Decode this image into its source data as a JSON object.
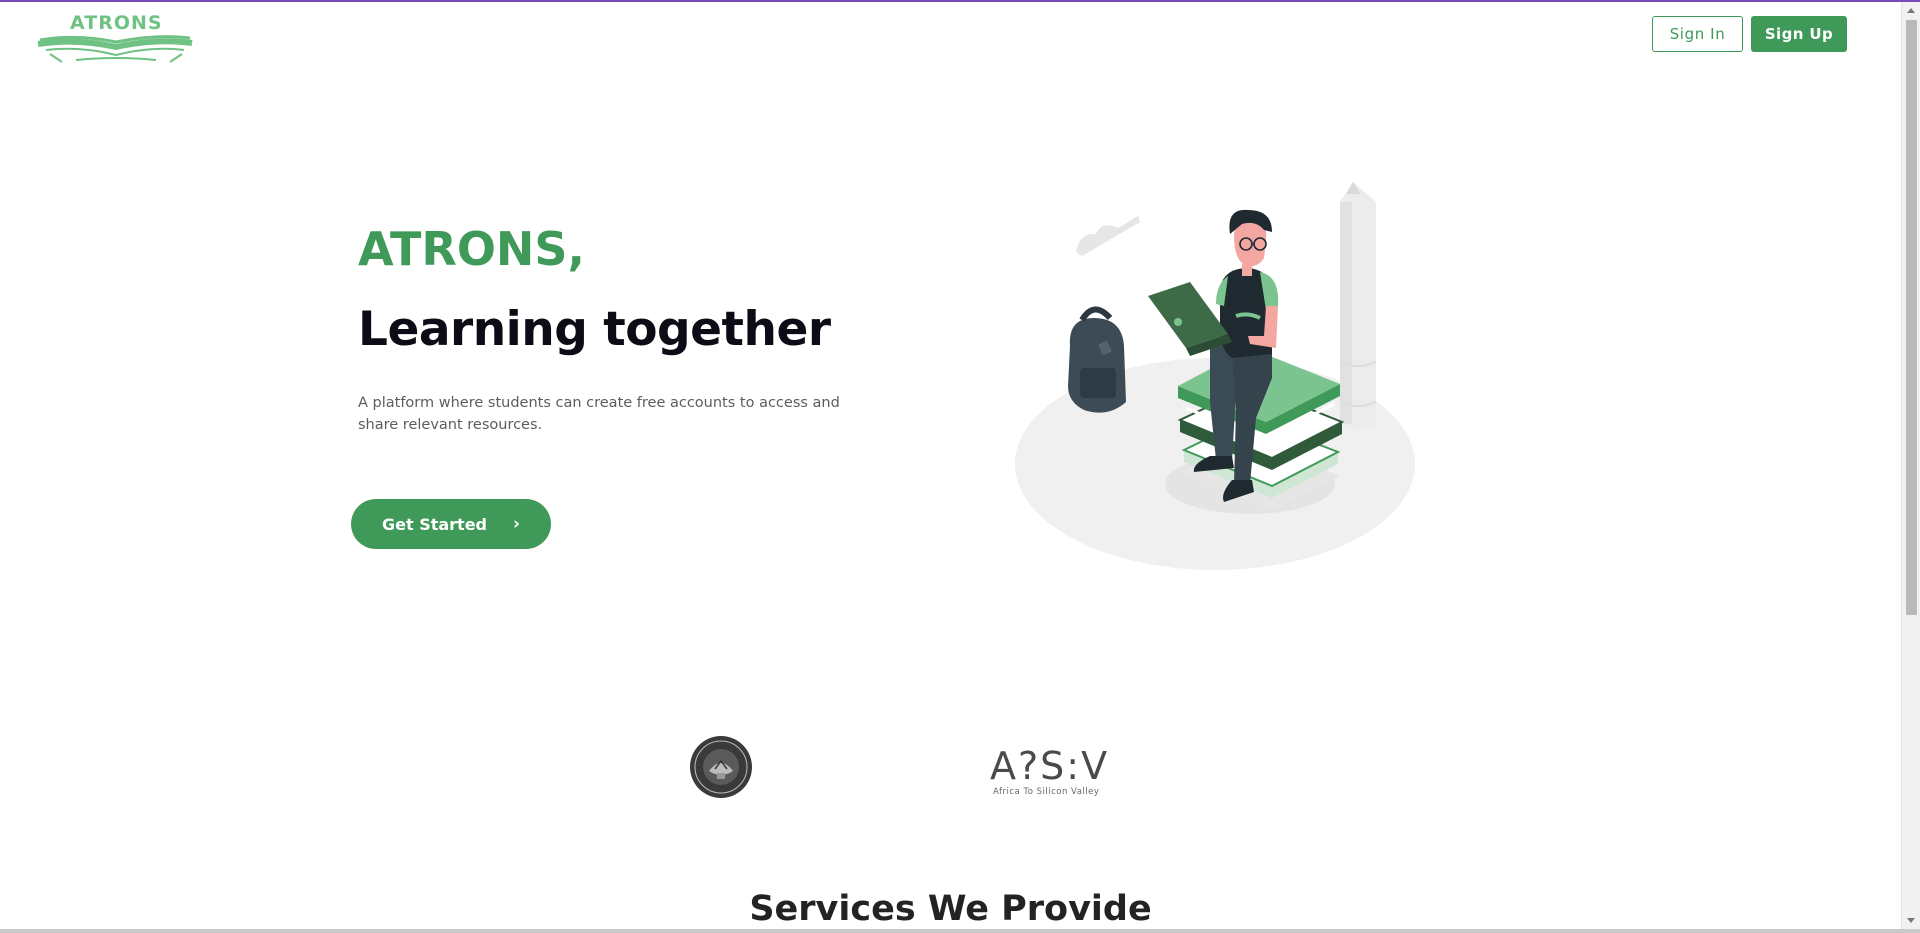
{
  "brand": {
    "logo_text": "ATRONS",
    "accent_color": "#3f9a59",
    "logo_color": "#6fc284"
  },
  "nav": {
    "sign_in_label": "Sign In",
    "sign_up_label": "Sign Up"
  },
  "hero": {
    "title_line1": "ATRONS,",
    "title_line2": "Learning together",
    "description": "A platform where students can create free accounts to access and share relevant resources.",
    "cta_label": "Get Started",
    "cta_icon": "chevron-right-icon",
    "illustration": "student-with-laptop-on-books-illustration"
  },
  "partners": [
    {
      "name": "addis-ababa-university-seal"
    },
    {
      "mark": "A?S:V",
      "subtitle": "Africa To Silicon Valley"
    }
  ],
  "services": {
    "title": "Services We Provide"
  }
}
